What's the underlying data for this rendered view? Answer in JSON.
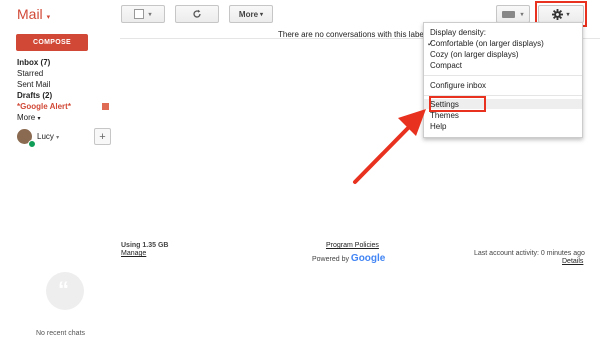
{
  "header": {
    "app_title": "Mail",
    "more_label": "More"
  },
  "sidebar": {
    "compose_label": "COMPOSE",
    "items": [
      {
        "label": "Inbox (7)"
      },
      {
        "label": "Starred"
      },
      {
        "label": "Sent Mail"
      },
      {
        "label": "Drafts (2)"
      },
      {
        "label": "*Google Alert*"
      },
      {
        "label": "More"
      }
    ],
    "user_name": "Lucy"
  },
  "main": {
    "empty_message": "There are no conversations with this label"
  },
  "settings_menu": {
    "density_heading": "Display density:",
    "density_options": [
      {
        "label": "Comfortable (on larger displays)",
        "checked": true
      },
      {
        "label": "Cozy (on larger displays)",
        "checked": false
      },
      {
        "label": "Compact",
        "checked": false
      }
    ],
    "configure_inbox": "Configure inbox",
    "settings": "Settings",
    "themes": "Themes",
    "help": "Help"
  },
  "footer": {
    "storage_used": "Using 1.35 GB",
    "manage_link": "Manage",
    "program_policies": "Program Policies",
    "powered_by": "Powered by",
    "google_logo_text": "Google",
    "last_activity": "Last account activity: 0 minutes ago",
    "details_link": "Details"
  },
  "chat": {
    "no_recent_chats": "No recent chats"
  },
  "colors": {
    "accent_red": "#d14836",
    "annotation_red": "#e8311f"
  },
  "icons": [
    "checkbox-icon",
    "refresh-icon",
    "keyboard-icon",
    "gear-icon",
    "add-icon",
    "hangouts-icon",
    "annotation-arrow"
  ]
}
